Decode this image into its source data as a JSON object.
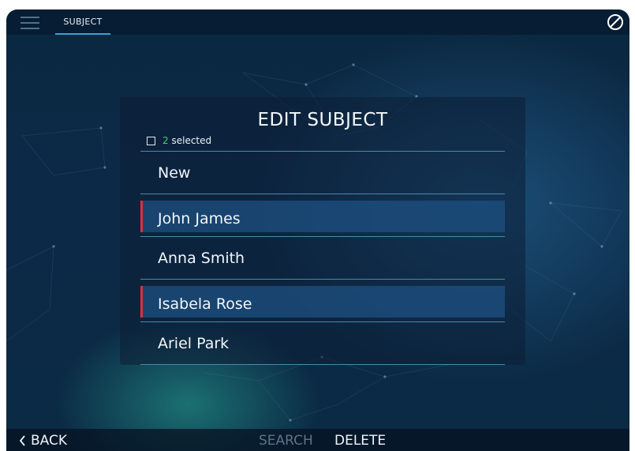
{
  "header": {
    "tab_label": "SUBJECT"
  },
  "panel": {
    "title": "EDIT SUBJECT",
    "selected_count": "2",
    "selected_suffix": "selected",
    "items": [
      {
        "label": "New",
        "selected": false
      },
      {
        "label": "John James",
        "selected": true
      },
      {
        "label": "Anna Smith",
        "selected": false
      },
      {
        "label": "Isabela Rose",
        "selected": true
      },
      {
        "label": "Ariel Park",
        "selected": false
      }
    ]
  },
  "footer": {
    "back_label": "BACK",
    "search_label": "SEARCH",
    "delete_label": "DELETE"
  },
  "colors": {
    "accent": "#3aa0d8",
    "selection_marker": "#d8323a",
    "count_green": "#3fd06a",
    "disabled_text": "#5d7488"
  }
}
